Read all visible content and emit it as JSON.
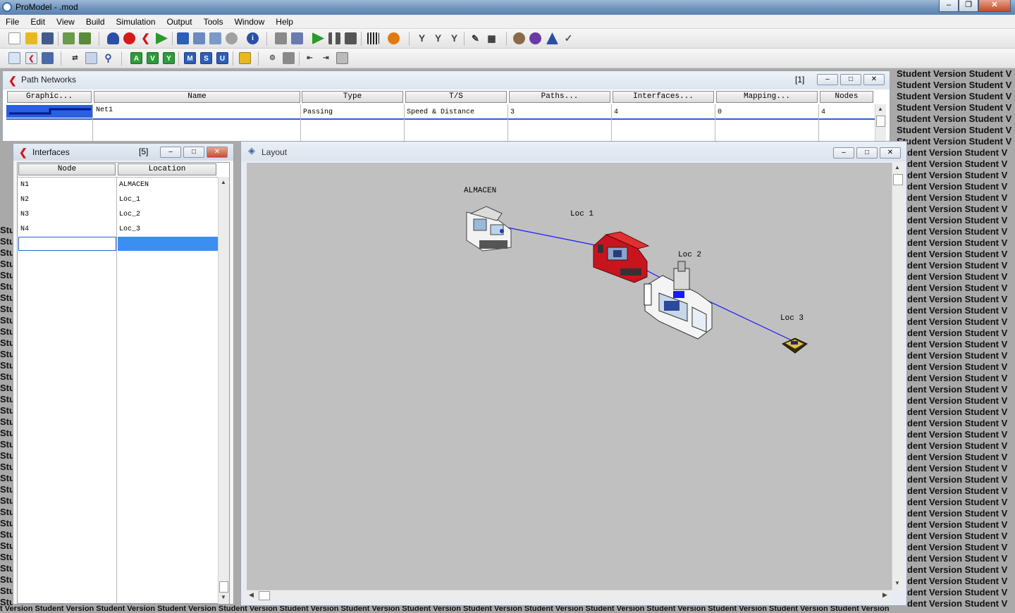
{
  "window": {
    "title": "ProModel - .mod"
  },
  "window_controls": {
    "minimize": "–",
    "maximize": "❐",
    "close": "✕"
  },
  "menu": [
    "File",
    "Edit",
    "View",
    "Build",
    "Simulation",
    "Output",
    "Tools",
    "Window",
    "Help"
  ],
  "toolbar2_letters": [
    "A",
    "V",
    "Y",
    "M",
    "S",
    "U"
  ],
  "watermark": {
    "right": "Student Version Student V",
    "right_cut": "dent Version Student V",
    "left": "Stu",
    "bottom": "t Version Student Version Student Version Student Version Student Version Student Version Student Version Student Version Student Version Student Version Student Version Student Version Student Version Student Version Student Version"
  },
  "path_networks": {
    "title": "Path Networks",
    "record_count": "[1]",
    "columns": [
      "Graphic...",
      "Name",
      "Type",
      "T/S",
      "Paths...",
      "Interfaces...",
      "Mapping...",
      "Nodes"
    ],
    "row": {
      "name": "Net1",
      "type": "Passing",
      "ts": "Speed & Distance",
      "paths": "3",
      "interfaces": "4",
      "mapping": "0",
      "nodes": "4"
    }
  },
  "interfaces": {
    "title": "Interfaces",
    "record_count": "[5]",
    "columns": [
      "Node",
      "Location"
    ],
    "rows": [
      {
        "node": "N1",
        "location": "ALMACEN"
      },
      {
        "node": "N2",
        "location": "Loc_1"
      },
      {
        "node": "N3",
        "location": "Loc_2"
      },
      {
        "node": "N4",
        "location": "Loc_3"
      }
    ]
  },
  "layout": {
    "title": "Layout",
    "locations": [
      "ALMACEN",
      "Loc 1",
      "Loc 2",
      "Loc 3"
    ],
    "colors": {
      "canvas": "#c0c0c0",
      "path": "#1a1aff",
      "loc1_machine": "#c8141e"
    }
  }
}
